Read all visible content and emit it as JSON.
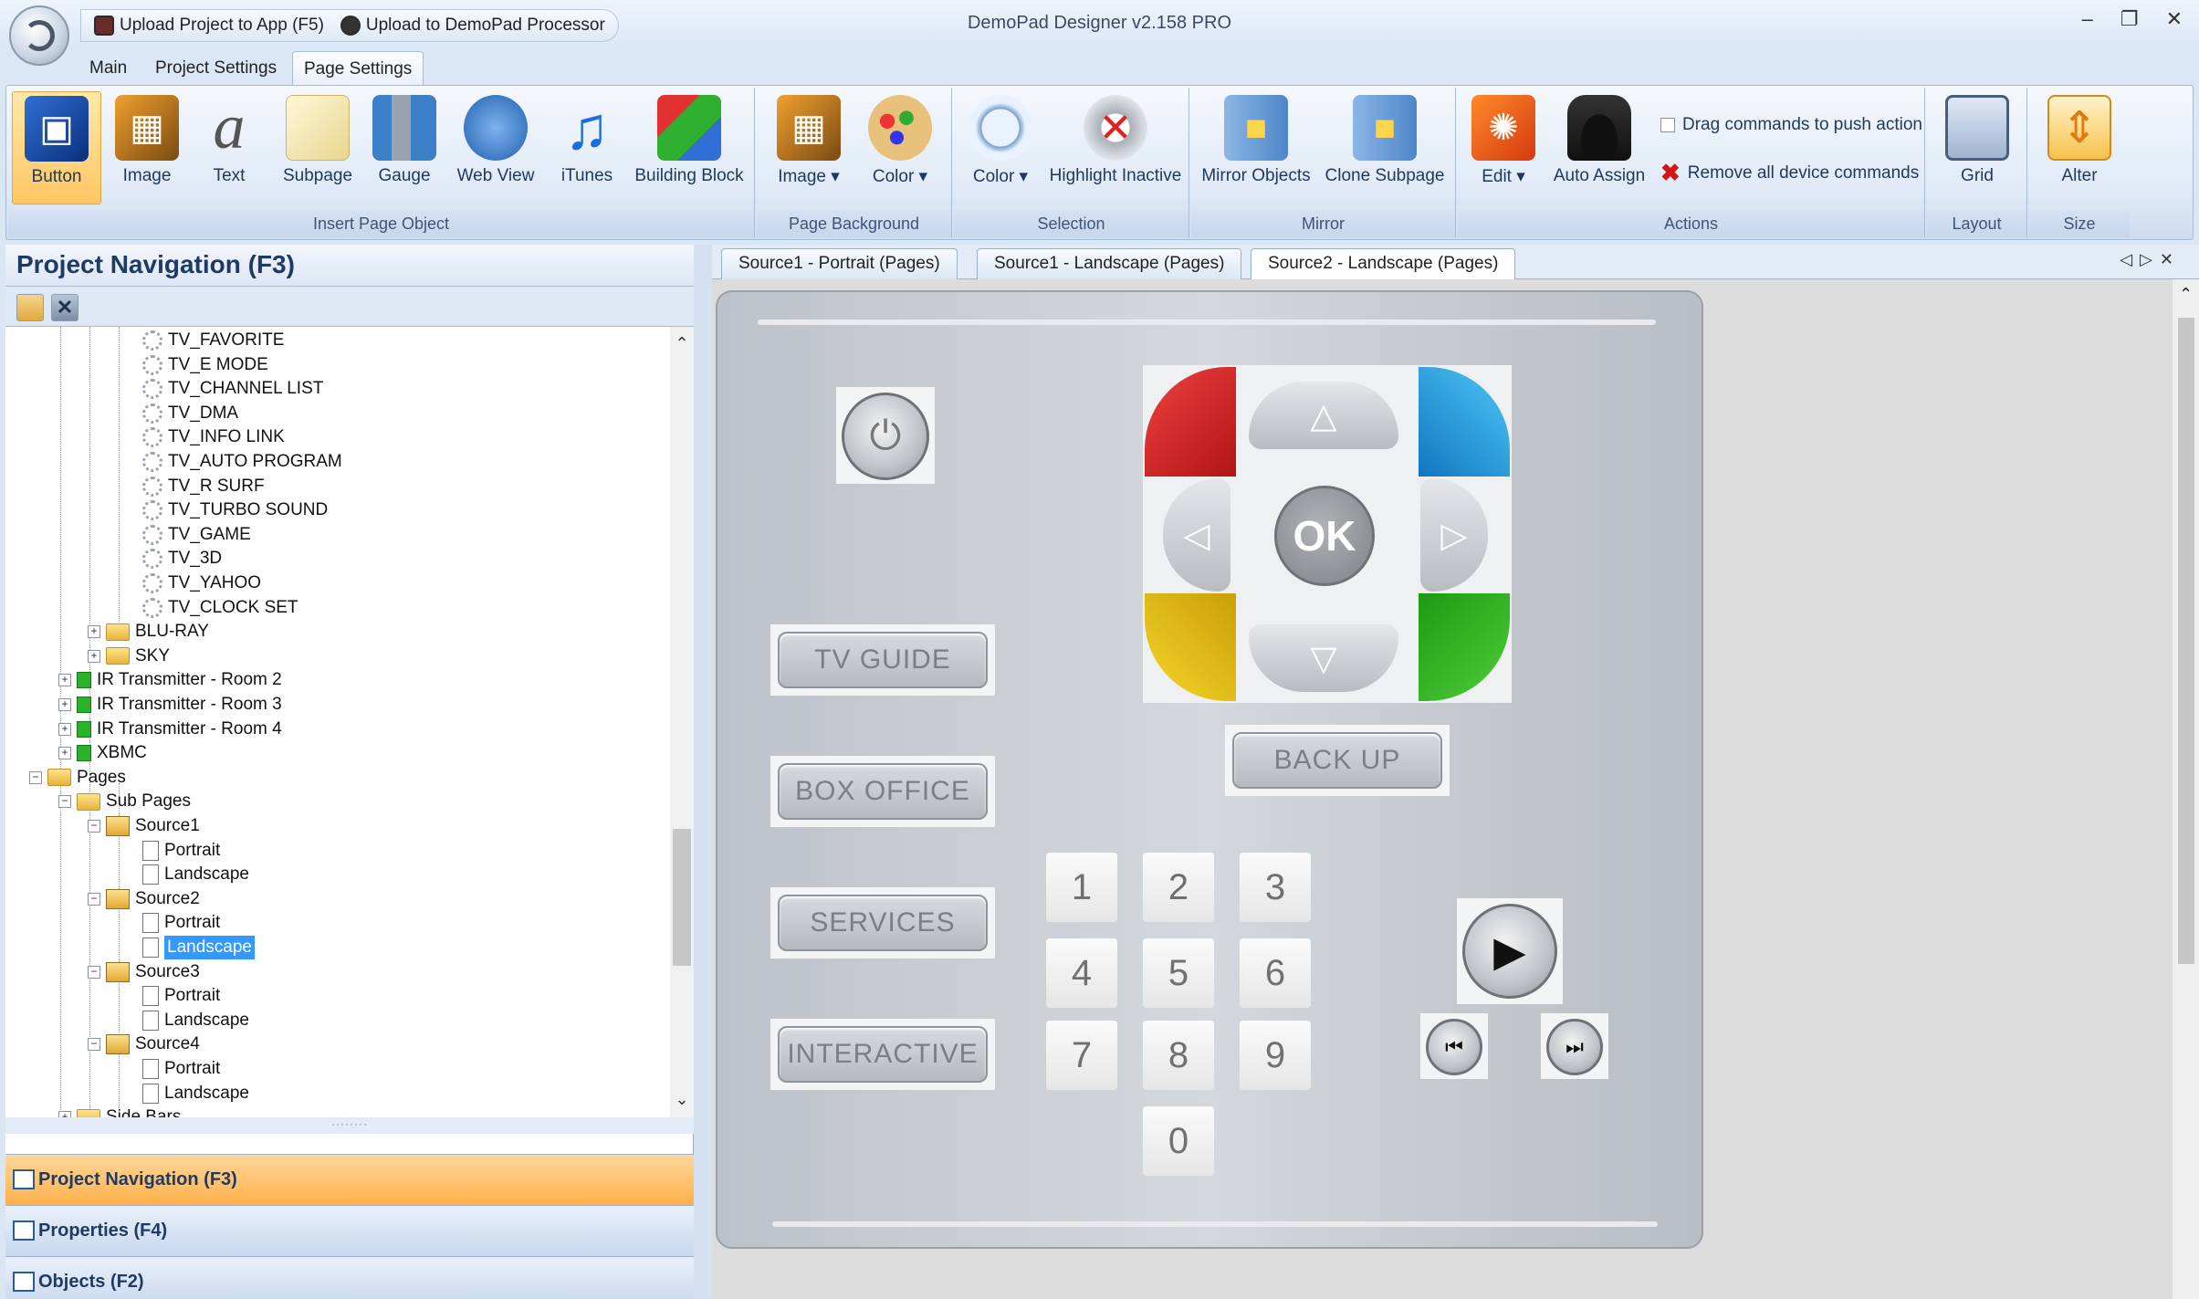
{
  "app": {
    "title": "DemoPad Designer v2.158 PRO",
    "qat": [
      "Upload Project to App (F5)",
      "Upload to DemoPad Processor"
    ],
    "window_buttons": [
      "–",
      "❐",
      "✕"
    ]
  },
  "ribbon_tabs": [
    "Main",
    "Project Settings",
    "Page Settings"
  ],
  "ribbon": {
    "insert_group": "Insert Page Object",
    "insert": [
      "Button",
      "Image",
      "Text",
      "Subpage",
      "Gauge",
      "Web View",
      "iTunes",
      "Building Block"
    ],
    "background_group": "Page Background",
    "background": [
      "Image ▾",
      "Color ▾"
    ],
    "selection_group": "Selection",
    "selection": [
      "Color ▾",
      "Highlight Inactive"
    ],
    "mirror_group": "Mirror",
    "mirror": [
      "Mirror Objects",
      "Clone Subpage"
    ],
    "actions_group": "Actions",
    "actions": [
      "Edit ▾",
      "Auto Assign"
    ],
    "drag_cmd": "Drag commands to push action",
    "remove_cmd": "Remove all device commands",
    "layout_group": "Layout",
    "layout": [
      "Grid"
    ],
    "size_group": "Size",
    "size": [
      "Alter"
    ]
  },
  "nav": {
    "title": "Project Navigation (F3)",
    "tree": [
      "TV_FAVORITE",
      "TV_E MODE",
      "TV_CHANNEL LIST",
      "TV_DMA",
      "TV_INFO LINK",
      "TV_AUTO PROGRAM",
      "TV_R SURF",
      "TV_TURBO SOUND",
      "TV_GAME",
      "TV_3D",
      "TV_YAHOO",
      "TV_CLOCK SET",
      "BLU-RAY",
      "SKY",
      "IR Transmitter - Room 2",
      "IR Transmitter - Room 3",
      "IR Transmitter - Room 4",
      "XBMC",
      "Pages",
      "Sub Pages",
      "Source1",
      "Portrait",
      "Landscape",
      "Source2",
      "Portrait",
      "Landscape",
      "Source3",
      "Portrait",
      "Landscape",
      "Source4",
      "Portrait",
      "Landscape",
      "Side Bars"
    ]
  },
  "panels": [
    "Project Navigation (F3)",
    "Properties (F4)",
    "Objects (F2)"
  ],
  "doc_tabs": [
    "Source1 - Portrait (Pages)",
    "Source1 - Landscape (Pages)",
    "Source2 - Landscape (Pages)"
  ],
  "canvas": {
    "buttons": [
      "TV GUIDE",
      "BOX OFFICE",
      "SERVICES",
      "INTERACTIVE"
    ],
    "back": "BACK UP",
    "ok": "OK",
    "numbers": [
      "1",
      "2",
      "3",
      "4",
      "5",
      "6",
      "7",
      "8",
      "9",
      "0"
    ]
  }
}
